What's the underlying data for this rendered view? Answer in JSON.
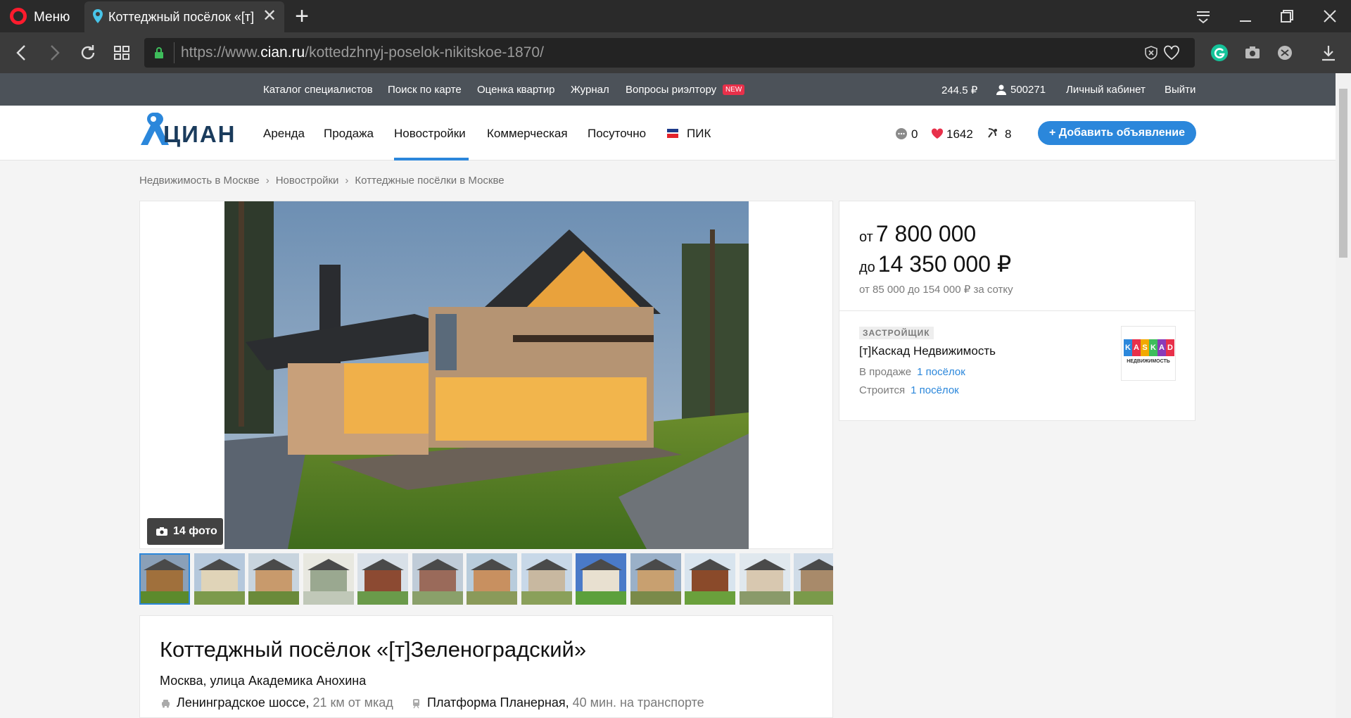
{
  "browser": {
    "menu_label": "Меню",
    "tab_title": "Коттеджный посёлок «[т]",
    "url_prefix": "https://www.",
    "url_host": "cian.ru",
    "url_path": "/kottedzhnyj-poselok-nikitskoe-1870/"
  },
  "topstrip": {
    "links": [
      "Каталог специалистов",
      "Поиск по карте",
      "Оценка квартир",
      "Журнал",
      "Вопросы риэлтору"
    ],
    "new_badge": "NEW",
    "balance": "244.5 ₽",
    "user_id": "500271",
    "cabinet": "Личный кабинет",
    "logout": "Выйти"
  },
  "header": {
    "logo_text": "ЦИАН",
    "nav": [
      "Аренда",
      "Продажа",
      "Новостройки",
      "Коммерческая",
      "Посуточно",
      "ПИК"
    ],
    "active_nav": "Новостройки",
    "messages_count": "0",
    "favorites_count": "1642",
    "compare_count": "8",
    "add_button": "+ Добавить объявление",
    "brand_color": "#2b87db"
  },
  "breadcrumbs": [
    "Недвижимость в Москве",
    "Новостройки",
    "Коттеджные посёлки в Москве"
  ],
  "gallery": {
    "photo_count_label": "14 фото",
    "thumbnail_count": 13
  },
  "listing": {
    "title": "Коттеджный посёлок «[т]Зеленоградский»",
    "address": "Москва, улица Академика Анохина",
    "highway": "Ленинградское шоссе,",
    "highway_distance": "21 км от мкад",
    "station": "Платформа Планерная,",
    "station_distance": "40 мин. на транспорте"
  },
  "price_card": {
    "from_prefix": "от",
    "price_from": "7 800 000",
    "to_prefix": "до",
    "price_to": "14 350 000 ₽",
    "per_sotka": "от 85 000 до 154 000 ₽ за сотку",
    "developer_tag": "ЗАСТРОЙЩИК",
    "developer_name": "[т]Каскад Недвижимость",
    "on_sale_label": "В продаже",
    "on_sale_link": "1 посёлок",
    "building_label": "Строится",
    "building_link": "1 посёлок",
    "developer_logo_text": "KASKAD",
    "developer_logo_sub": "НЕДВИЖИМОСТЬ"
  }
}
